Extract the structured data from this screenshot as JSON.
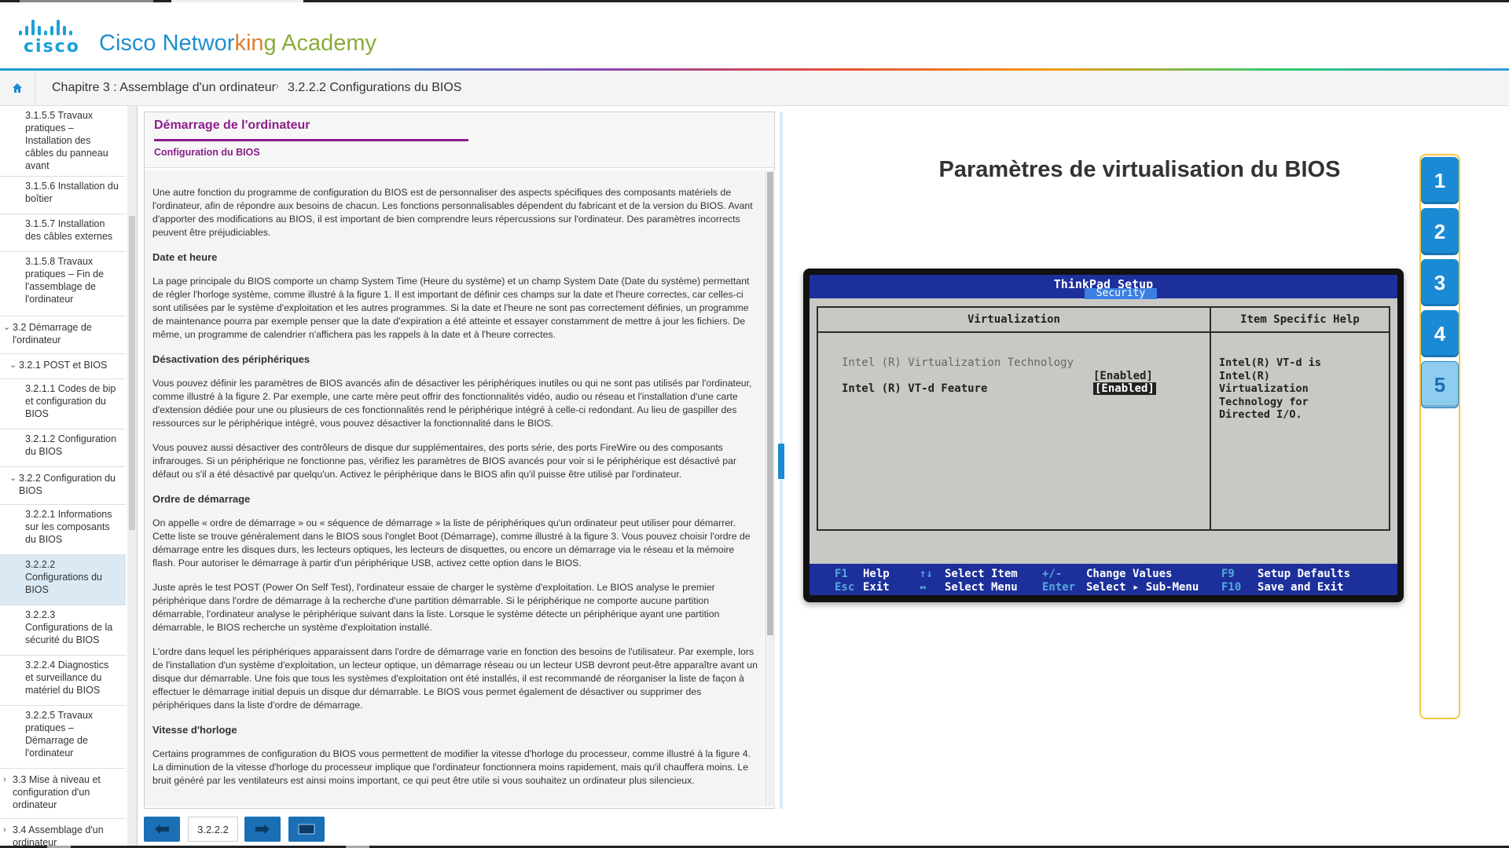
{
  "header": {
    "logo_word": "cisco",
    "academy_a": "Cisco Networ",
    "academy_b": "kin",
    "academy_c": "g Academy"
  },
  "breadcrumb": {
    "chapter": "Chapitre 3 : Assemblage d'un ordinateur",
    "separator": "›",
    "current": "3.2.2.2 Configurations du BIOS"
  },
  "sidebar": {
    "items": [
      {
        "label": "3.1.5.5 Travaux pratiques – Installation des câbles du panneau avant"
      },
      {
        "label": "3.1.5.6 Installation du boîtier"
      },
      {
        "label": "3.1.5.7 Installation des câbles externes"
      },
      {
        "label": "3.1.5.8 Travaux pratiques – Fin de l'assemblage de l'ordinateur"
      },
      {
        "label": "3.2 Démarrage de l'ordinateur"
      },
      {
        "label": "3.2.1 POST et BIOS"
      },
      {
        "label": "3.2.1.1 Codes de bip et configuration du BIOS"
      },
      {
        "label": "3.2.1.2 Configuration du BIOS"
      },
      {
        "label": "3.2.2 Configuration du BIOS"
      },
      {
        "label": "3.2.2.1 Informations sur les composants du BIOS"
      },
      {
        "label": "3.2.2.2 Configurations du BIOS"
      },
      {
        "label": "3.2.2.3 Configurations de la sécurité du BIOS"
      },
      {
        "label": "3.2.2.4 Diagnostics et surveillance du matériel du BIOS"
      },
      {
        "label": "3.2.2.5 Travaux pratiques – Démarrage de l'ordinateur"
      },
      {
        "label": "3.3 Mise à niveau et configuration d'un ordinateur"
      },
      {
        "label": "3.4 Assemblage d'un ordinateur"
      }
    ]
  },
  "content": {
    "title": "Démarrage de l'ordinateur",
    "subtitle": "Configuration du BIOS",
    "p1": "Une autre fonction du programme de configuration du BIOS est de personnaliser des aspects spécifiques des composants matériels de l'ordinateur, afin de répondre aux besoins de chacun. Les fonctions personnalisables dépendent du fabricant et de la version du BIOS. Avant d'apporter des modifications au BIOS, il est important de bien comprendre leurs répercussions sur l'ordinateur. Des paramètres incorrects peuvent être préjudiciables.",
    "h_date": "Date et heure",
    "p2": "La page principale du BIOS comporte un champ System Time (Heure du système) et un champ System Date (Date du système) permettant de régler l'horloge système, comme illustré à la figure 1. Il est important de définir ces champs sur la date et l'heure correctes, car celles-ci sont utilisées par le système d'exploitation et les autres programmes. Si la date et l'heure ne sont pas correctement définies, un programme de maintenance pourra par exemple penser que la date d'expiration a été atteinte et essayer constamment de mettre à jour les fichiers. De même, un programme de calendrier n'affichera pas les rappels à la date et à l'heure correctes.",
    "h_devices": "Désactivation des périphériques",
    "p3": "Vous pouvez définir les paramètres de BIOS avancés afin de désactiver les périphériques inutiles ou qui ne sont pas utilisés par l'ordinateur, comme illustré à la figure 2. Par exemple, une carte mère peut offrir des fonctionnalités vidéo, audio ou réseau et l'installation d'une carte d'extension dédiée pour une ou plusieurs de ces fonctionnalités rend le périphérique intégré à celle-ci redondant. Au lieu de gaspiller des ressources sur le périphérique intégré, vous pouvez désactiver la fonctionnalité dans le BIOS.",
    "p4": "Vous pouvez aussi désactiver des contrôleurs de disque dur supplémentaires, des ports série, des ports FireWire ou des composants infrarouges. Si un périphérique ne fonctionne pas, vérifiez les paramètres de BIOS avancés pour voir si le périphérique est désactivé par défaut ou s'il a été désactivé par quelqu'un. Activez le périphérique dans le BIOS afin qu'il puisse être utilisé par l'ordinateur.",
    "h_boot": "Ordre de démarrage",
    "p5": "On appelle « ordre de démarrage » ou « séquence de démarrage » la liste de périphériques qu'un ordinateur peut utiliser pour démarrer. Cette liste se trouve généralement dans le BIOS sous l'onglet Boot (Démarrage), comme illustré à la figure 3. Vous pouvez choisir l'ordre de démarrage entre les disques durs, les lecteurs optiques, les lecteurs de disquettes, ou encore un démarrage via le réseau et la mémoire flash. Pour autoriser le démarrage à partir d'un périphérique USB, activez cette option dans le BIOS.",
    "p6": "Juste après le test POST (Power On Self Test), l'ordinateur essaie de charger le système d'exploitation. Le BIOS analyse le premier périphérique dans l'ordre de démarrage à la recherche d'une partition démarrable. Si le périphérique ne comporte aucune partition démarrable, l'ordinateur analyse le périphérique suivant dans la liste. Lorsque le système détecte un périphérique ayant une partition démarrable, le BIOS recherche un système d'exploitation installé.",
    "p7": "L'ordre dans lequel les périphériques apparaissent dans l'ordre de démarrage varie en fonction des besoins de l'utilisateur. Par exemple, lors de l'installation d'un système d'exploitation, un lecteur optique, un démarrage réseau ou un lecteur USB devront peut-être apparaître avant un disque dur démarrable. Une fois que tous les systèmes d'exploitation ont été installés, il est recommandé de réorganiser la liste de façon à effectuer le démarrage initial depuis un disque dur démarrable. Le BIOS vous permet également de désactiver ou supprimer des périphériques dans la liste d'ordre de démarrage.",
    "h_clock": "Vitesse d'horloge",
    "p8": "Certains programmes de configuration du BIOS vous permettent de modifier la vitesse d'horloge du processeur, comme illustré à la figure 4. La diminution de la vitesse d'horloge du processeur implique que l'ordinateur fonctionnera moins rapidement, mais qu'il chauffera moins. Le bruit généré par les ventilateurs est ainsi moins important, ce qui peut être utile si vous souhaitez un ordinateur plus silencieux."
  },
  "footer_nav": {
    "page": "3.2.2.2"
  },
  "media": {
    "title": "Paramètres de virtualisation du BIOS",
    "bios": {
      "window_title": "ThinkPad Setup",
      "tab": "Security",
      "left_header": "Virtualization",
      "right_header": "Item Specific Help",
      "option1": "Intel (R) Virtualization Technology",
      "value1": "[Enabled]",
      "option2": "Intel (R) VT-d Feature",
      "value2": "[Enabled]",
      "help": "Intel(R) VT-d is\nIntel(R)\nVirtualization\nTechnology for\nDirected I/O.",
      "footer": {
        "k_f1": "F1",
        "l_help": "Help",
        "k_arrows_v": "↑↓",
        "l_select_item": "Select Item",
        "k_pm": "+/-",
        "l_change": "Change Values",
        "k_f9": "F9",
        "l_defaults": "Setup Defaults",
        "k_esc": "Esc",
        "l_exit": "Exit",
        "k_arrows_h": "↔",
        "l_select_menu": "Select Menu",
        "k_enter": "Enter",
        "l_submenu": "Select ▸ Sub-Menu",
        "k_f10": "F10",
        "l_save": "Save and Exit"
      }
    }
  },
  "figures": {
    "buttons": [
      "1",
      "2",
      "3",
      "4",
      "5"
    ],
    "active": "5"
  },
  "colors": {
    "accent_blue": "#1a8ad4",
    "title_purple": "#8b1e8b",
    "bios_blue": "#1d2f9a"
  }
}
